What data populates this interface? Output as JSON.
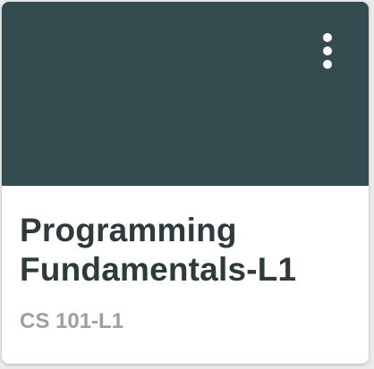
{
  "colors": {
    "header_bg": "#344b4f",
    "icon": "#ffffff",
    "title": "#2e3a3c",
    "subtitle": "#9aa1a3"
  },
  "card": {
    "title": "Programming Fundamentals-L1",
    "code": "CS 101-L1",
    "menu_icon": "more-vertical-icon"
  }
}
